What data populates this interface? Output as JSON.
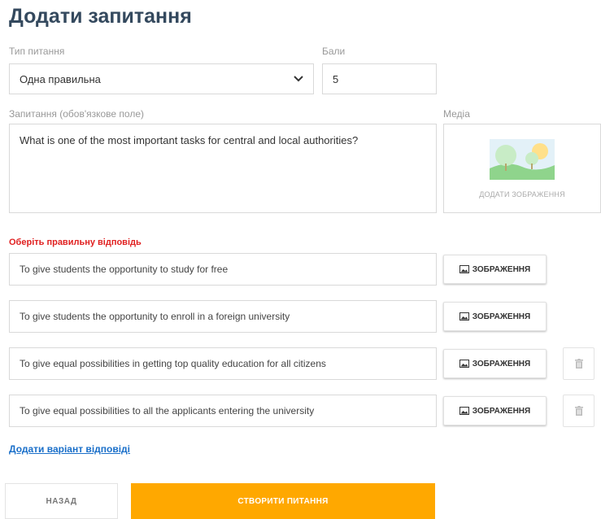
{
  "page": {
    "title": "Додати запитання"
  },
  "form": {
    "type_label": "Тип питання",
    "type_value": "Одна правильна",
    "points_label": "Бали",
    "points_value": "5",
    "question_label": "Запитання (обов'язкове поле)",
    "question_value": "What is one of the most important tasks for central and local authorities?",
    "media_label": "Медіа",
    "media_add_label": "ДОДАТИ ЗОБРАЖЕННЯ"
  },
  "answers": {
    "prompt": "Оберіть правильну відповідь",
    "image_button_label": "ЗОБРАЖЕННЯ",
    "items": [
      {
        "text": "To give students the opportunity to study for free",
        "deletable": false
      },
      {
        "text": "To give students the opportunity to enroll in a foreign university",
        "deletable": false
      },
      {
        "text": "To give equal possibilities in getting top quality education for all citizens",
        "deletable": true
      },
      {
        "text": "To give equal possibilities to all the applicants entering the university",
        "deletable": true
      }
    ],
    "add_label": "Додати варіант відповіді"
  },
  "actions": {
    "back_label": "НАЗАД",
    "create_label": "СТВОРИТИ ПИТАННЯ"
  },
  "colors": {
    "title": "#34495e",
    "prompt": "#e02020",
    "link": "#1a6fc9",
    "primary": "#ffa800"
  },
  "icons": {
    "select": "chevron-down-icon",
    "media": "landscape-image-icon",
    "image_button": "image-icon",
    "delete": "trash-icon"
  }
}
